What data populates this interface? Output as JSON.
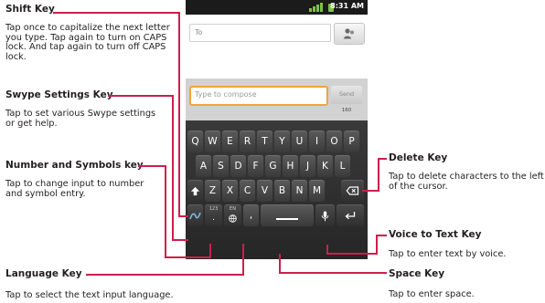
{
  "callouts": {
    "shift": {
      "title": "Shift Key",
      "desc": "Tap once to capitalize the next letter you type. Tap again to turn on CAPS lock. And tap again to turn off CAPS lock."
    },
    "swype_settings": {
      "title": "Swype Settings Key",
      "desc": "Tap to set various Swype settings or get help."
    },
    "number_symbols": {
      "title": "Number and Symbols key",
      "desc": "Tap to change input to number and symbol entry."
    },
    "language": {
      "title": "Language Key",
      "desc": "Tap to select the text input language."
    },
    "delete": {
      "title": "Delete Key",
      "desc": "Tap to delete characters to the left of the cursor."
    },
    "voice": {
      "title": "Voice to Text Key",
      "desc": "Tap to enter text by voice."
    },
    "space": {
      "title": "Space Key",
      "desc": "Tap to enter space."
    }
  },
  "phone": {
    "status_time": "8:31 AM",
    "to_placeholder": "To",
    "compose_placeholder": "Type to compose",
    "send_label": "Send",
    "char_count": "160"
  },
  "keyboard": {
    "row1": [
      "Q",
      "W",
      "E",
      "R",
      "T",
      "Y",
      "U",
      "I",
      "O",
      "P"
    ],
    "row2": [
      "A",
      "S",
      "D",
      "F",
      "G",
      "H",
      "J",
      "K",
      "L"
    ],
    "row3": [
      "Z",
      "X",
      "C",
      "V",
      "B",
      "N",
      "M"
    ],
    "num_key_label": "123",
    "lang_key_label": "EN",
    "comma": ",",
    "period": "."
  },
  "colors": {
    "leader_line": "#cc1f4b",
    "compose_border": "#f2a33a",
    "signal": "#7fc241"
  },
  "icons": [
    "contact-add-icon",
    "shift-arrow-icon",
    "delete-backspace-icon",
    "swype-logo-icon",
    "microphone-icon",
    "enter-return-icon",
    "globe-icon",
    "signal-bars-icon"
  ]
}
